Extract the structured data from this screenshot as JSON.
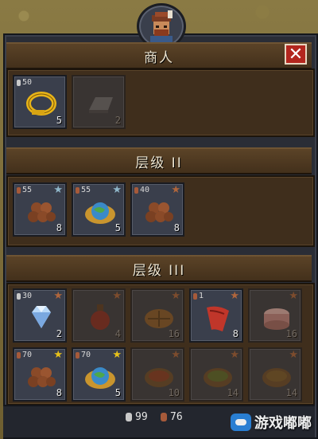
{
  "merchant": {
    "title": "商人",
    "close_label": "✕",
    "items": [
      {
        "id": "gold-ring",
        "price": "50",
        "currency": "silver",
        "qty": "5",
        "available": true
      },
      {
        "id": "iron-ingot",
        "price": "",
        "currency": "",
        "qty": "2",
        "available": false
      }
    ]
  },
  "tier2": {
    "title": "层级 II",
    "items": [
      {
        "id": "nuts",
        "price": "55",
        "currency": "bronze",
        "qty": "8",
        "star": "silver",
        "available": true
      },
      {
        "id": "planet-bowl",
        "price": "55",
        "currency": "bronze",
        "qty": "5",
        "star": "silver",
        "available": true
      },
      {
        "id": "nuts",
        "price": "40",
        "currency": "bronze",
        "qty": "8",
        "star": "bronze",
        "available": true
      }
    ]
  },
  "tier3": {
    "title": "层级 III",
    "items": [
      {
        "id": "diamond",
        "price": "30",
        "currency": "silver",
        "qty": "2",
        "star": "bronze",
        "available": true
      },
      {
        "id": "potion",
        "price": "",
        "currency": "",
        "qty": "4",
        "star": "bronze",
        "available": false
      },
      {
        "id": "pie",
        "price": "",
        "currency": "",
        "qty": "16",
        "star": "bronze",
        "available": false
      },
      {
        "id": "cloth",
        "price": "1",
        "currency": "bronze",
        "qty": "8",
        "star": "bronze",
        "available": true
      },
      {
        "id": "cake",
        "price": "",
        "currency": "",
        "qty": "16",
        "star": "bronze",
        "available": false
      },
      {
        "id": "nuts",
        "price": "70",
        "currency": "bronze",
        "qty": "8",
        "star": "gold",
        "available": true
      },
      {
        "id": "planet-bowl",
        "price": "70",
        "currency": "bronze",
        "qty": "5",
        "star": "gold",
        "available": true
      },
      {
        "id": "stew",
        "price": "",
        "currency": "",
        "qty": "10",
        "star": "bronze",
        "available": false
      },
      {
        "id": "stew",
        "price": "",
        "currency": "",
        "qty": "14",
        "star": "bronze",
        "available": false
      },
      {
        "id": "stew",
        "price": "",
        "currency": "",
        "qty": "14",
        "star": "bronze",
        "available": false
      }
    ]
  },
  "wallet": {
    "silver": "99",
    "bronze": "76"
  },
  "watermark": "游戏嘟嘟",
  "colors": {
    "star_gold": "#e8c21a",
    "star_silver": "#8fb6c9",
    "star_bronze": "#b0663c",
    "close": "#b3261e"
  }
}
